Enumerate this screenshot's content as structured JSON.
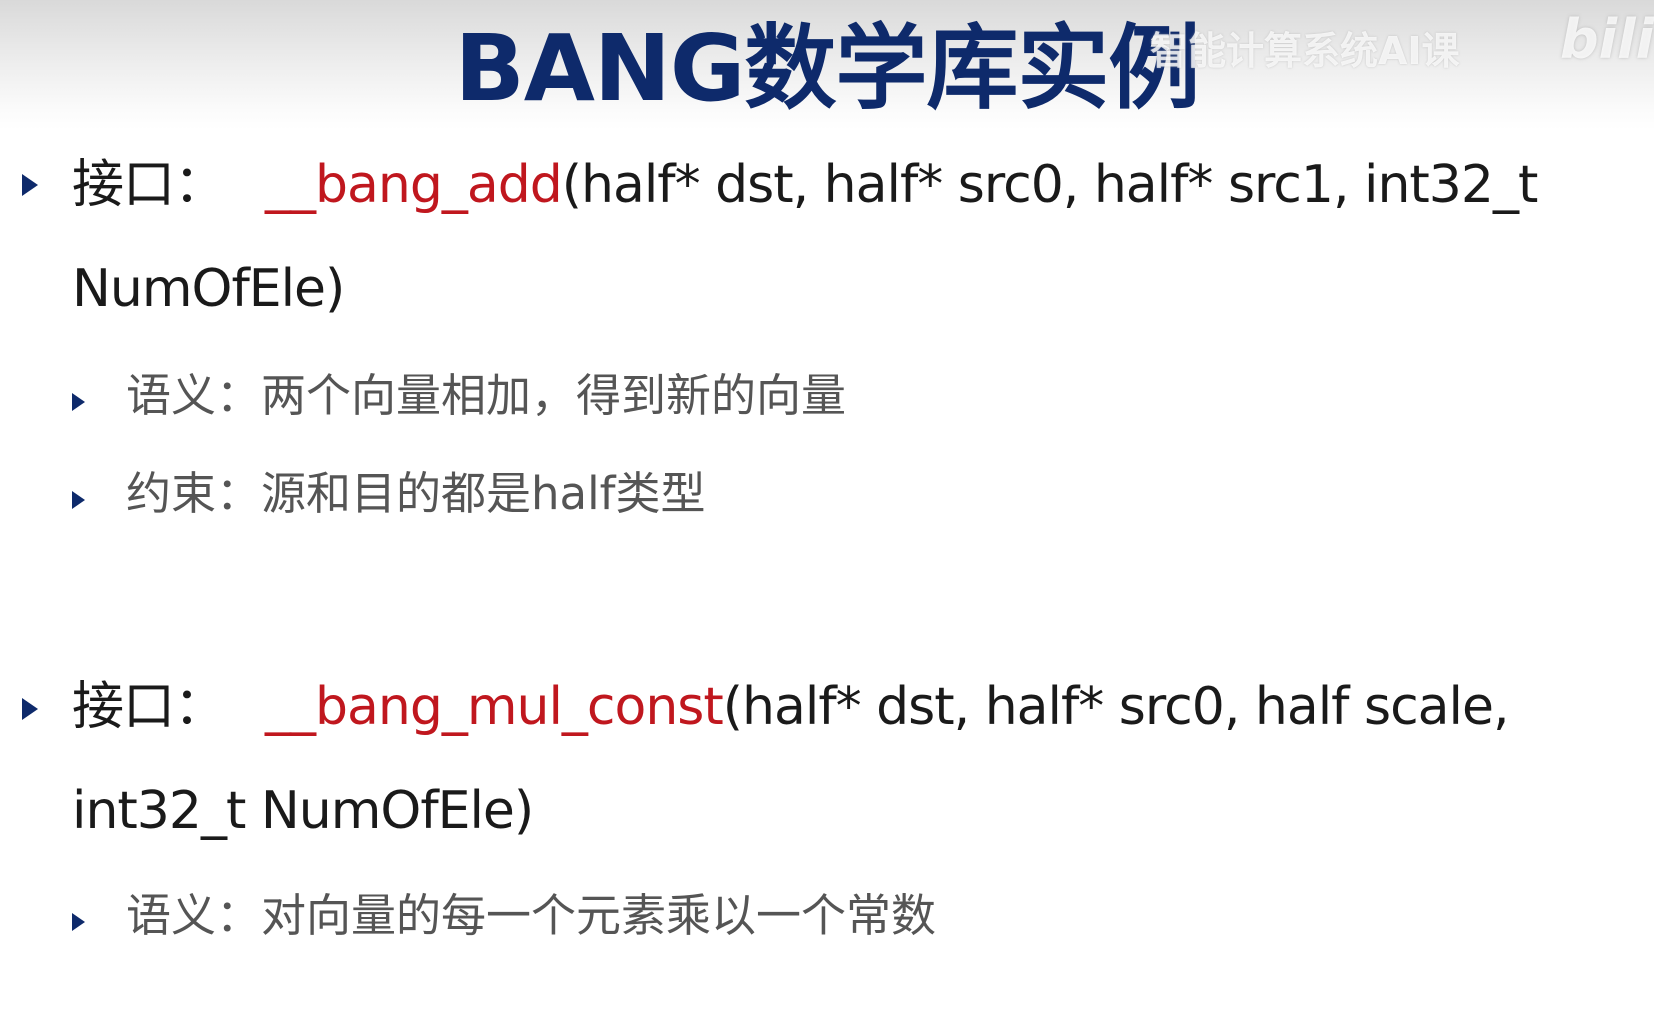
{
  "slide": {
    "title": "BANG数学库实例",
    "watermark": "智能计算系统AI课",
    "logo": "bili"
  },
  "items": [
    {
      "label": "接口：",
      "function_name": "__bang_add",
      "signature_line1": "(half* dst, half* src0, half*  src1, int32_t",
      "signature_line2": "NumOfEle)",
      "sub_items": [
        "语义：两个向量相加，得到新的向量",
        "约束：源和目的都是half类型"
      ]
    },
    {
      "label": "接口：",
      "function_name": "__bang_mul_const",
      "signature_line1": "(half* dst, half* src0, half scale,",
      "signature_line2": "int32_t NumOfEle)",
      "sub_items": [
        "语义：对向量的每一个元素乘以一个常数"
      ]
    }
  ],
  "colors": {
    "title": "#0e2a6b",
    "bullet": "#0e2a6b",
    "function_name": "#c0171e",
    "body_text": "#1a1a1a",
    "sub_text": "#555555"
  }
}
